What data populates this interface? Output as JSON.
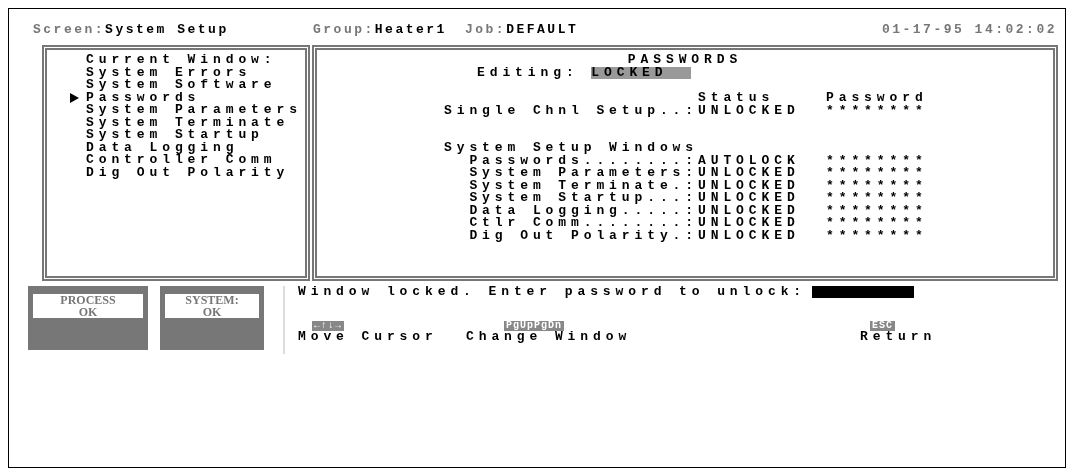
{
  "header": {
    "screen_label": "Screen:",
    "screen": "System Setup",
    "group_label": "Group:",
    "group": "Heater1",
    "job_label": "Job:",
    "job": "DEFAULT",
    "datetime": "01-17-95 14:02:02"
  },
  "menu": {
    "title": "Current Window:",
    "items": [
      {
        "label": "System Errors",
        "selected": false
      },
      {
        "label": "System Software",
        "selected": false
      },
      {
        "label": "Passwords",
        "selected": true
      },
      {
        "label": "System Parameters",
        "selected": false
      },
      {
        "label": "System Terminate",
        "selected": false
      },
      {
        "label": "System Startup",
        "selected": false
      },
      {
        "label": "Data Logging",
        "selected": false
      },
      {
        "label": "Controller Comm",
        "selected": false
      },
      {
        "label": "Dig Out Polarity",
        "selected": false
      }
    ]
  },
  "passwords": {
    "title": "PASSWORDS",
    "editing_label": "Editing:",
    "editing_value": "LOCKED",
    "status_heading": "Status",
    "password_heading": "Password",
    "single": {
      "label": "Single Chnl Setup..:",
      "status": "UNLOCKED",
      "password": "********"
    },
    "group_heading": "System Setup Windows",
    "rows": [
      {
        "label": "Passwords........:",
        "status": "AUTOLOCK",
        "password": "********"
      },
      {
        "label": "System Parameters:",
        "status": "UNLOCKED",
        "password": "********"
      },
      {
        "label": "System Terminate.:",
        "status": "UNLOCKED",
        "password": "********"
      },
      {
        "label": "System Startup...:",
        "status": "UNLOCKED",
        "password": "********"
      },
      {
        "label": "Data Logging.....:",
        "status": "UNLOCKED",
        "password": "********"
      },
      {
        "label": "Ctlr Comm........:",
        "status": "UNLOCKED",
        "password": "********"
      },
      {
        "label": "Dig Out Polarity.:",
        "status": "UNLOCKED",
        "password": "********"
      }
    ]
  },
  "indicators": [
    {
      "name": "PROCESS",
      "value": "OK"
    },
    {
      "name": "SYSTEM:",
      "value": "OK"
    }
  ],
  "prompt": "Window locked. Enter password to unlock:",
  "keys": [
    {
      "key": "←↑↓→",
      "action": "Move Cursor"
    },
    {
      "key": "PgUpPgDn",
      "action": "Change Window"
    },
    {
      "key": "ESC",
      "action": "Return"
    }
  ]
}
